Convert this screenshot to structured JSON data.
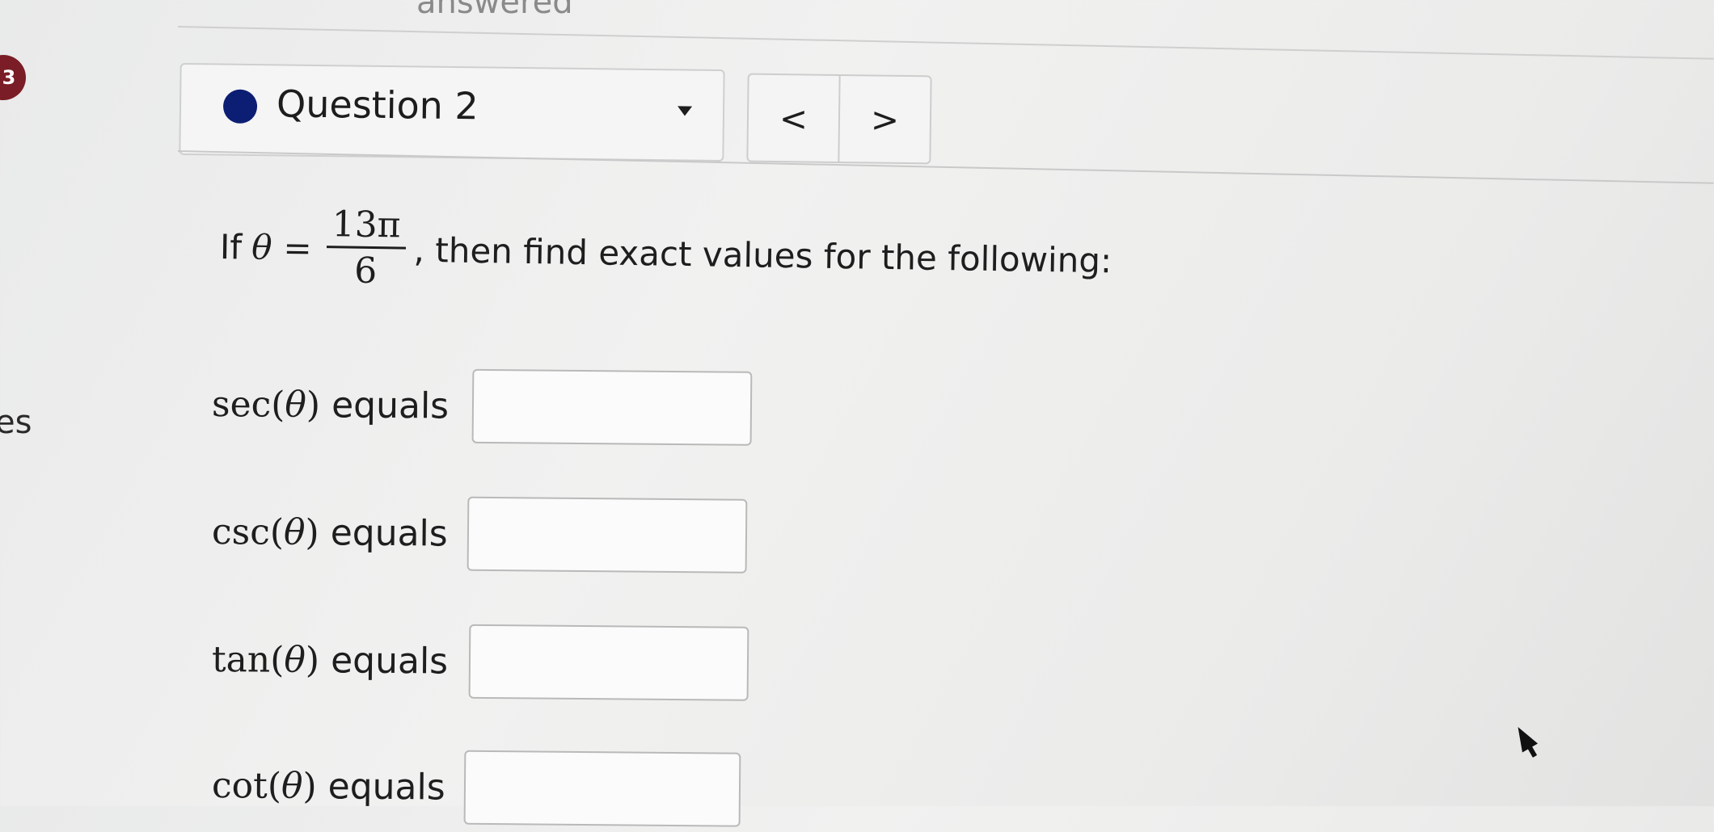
{
  "page": {
    "status_text": "answered",
    "side_badge": "3",
    "side_text": "es"
  },
  "question_selector": {
    "label": "Question 2",
    "status_color": "#0c1e73"
  },
  "navigation": {
    "prev_label": "<",
    "next_label": ">"
  },
  "problem": {
    "prefix": "If",
    "variable": "θ",
    "equals": "=",
    "numerator": "13π",
    "denominator": "6",
    "suffix": ", then find exact values for the following:"
  },
  "answers": [
    {
      "fn": "sec",
      "arg": "θ",
      "label": "equals",
      "value": ""
    },
    {
      "fn": "csc",
      "arg": "θ",
      "label": "equals",
      "value": ""
    },
    {
      "fn": "tan",
      "arg": "θ",
      "label": "equals",
      "value": ""
    },
    {
      "fn": "cot",
      "arg": "θ",
      "label": "equals",
      "value": ""
    }
  ]
}
